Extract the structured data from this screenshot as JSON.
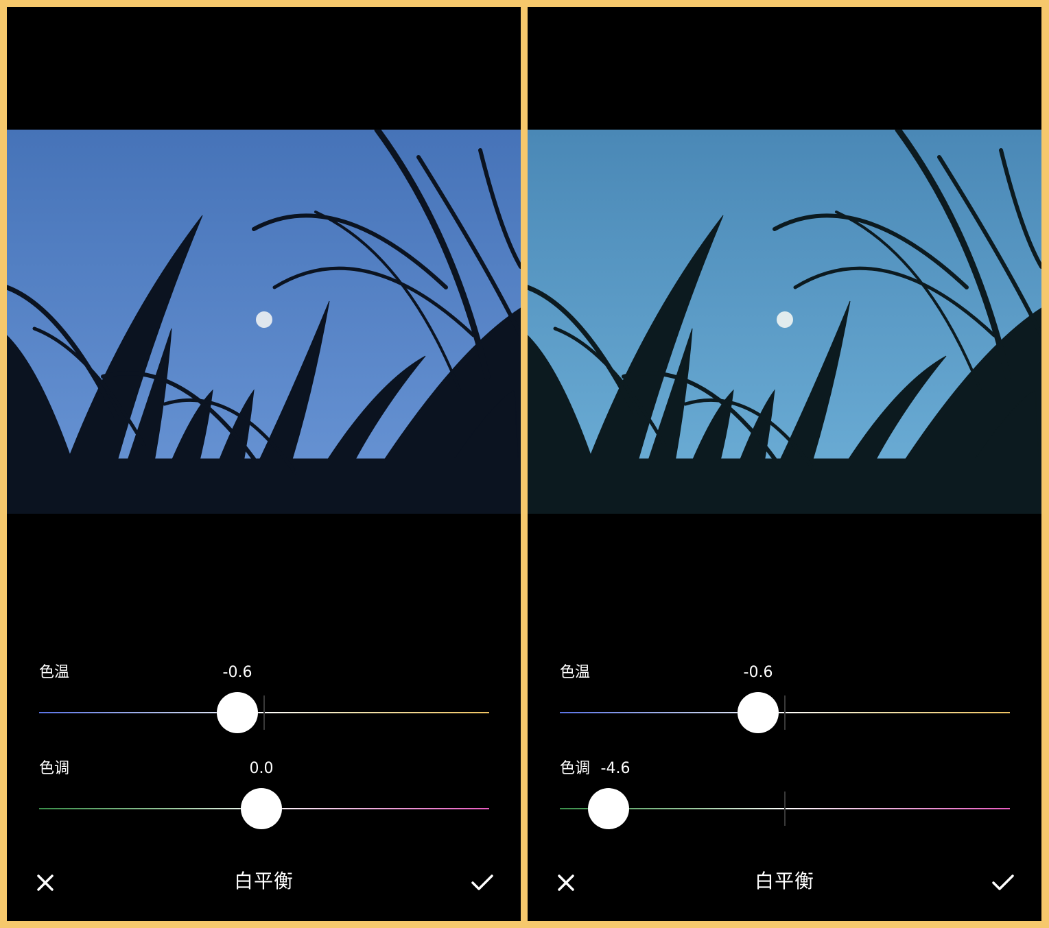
{
  "colors": {
    "frame": "#f6c86c",
    "sky_left": "#4d7cc4",
    "sky_right": "#4e93bf",
    "temp_cool": "#5a73e6",
    "temp_warm": "#f0c463",
    "tint_green": "#3a8f4a",
    "tint_magenta": "#e85cc0"
  },
  "panels": [
    {
      "title": "白平衡",
      "close_icon": "close-icon",
      "confirm_icon": "check-icon",
      "temperature": {
        "label": "色温",
        "value": "-0.6",
        "level": -0.06
      },
      "tint": {
        "label": "色调",
        "value": "0.0",
        "level": 0.0
      }
    },
    {
      "title": "白平衡",
      "close_icon": "close-icon",
      "confirm_icon": "check-icon",
      "temperature": {
        "label": "色温",
        "value": "-0.6",
        "level": -0.06
      },
      "tint": {
        "label": "色调",
        "value": "-4.6",
        "level": -0.46
      }
    }
  ]
}
